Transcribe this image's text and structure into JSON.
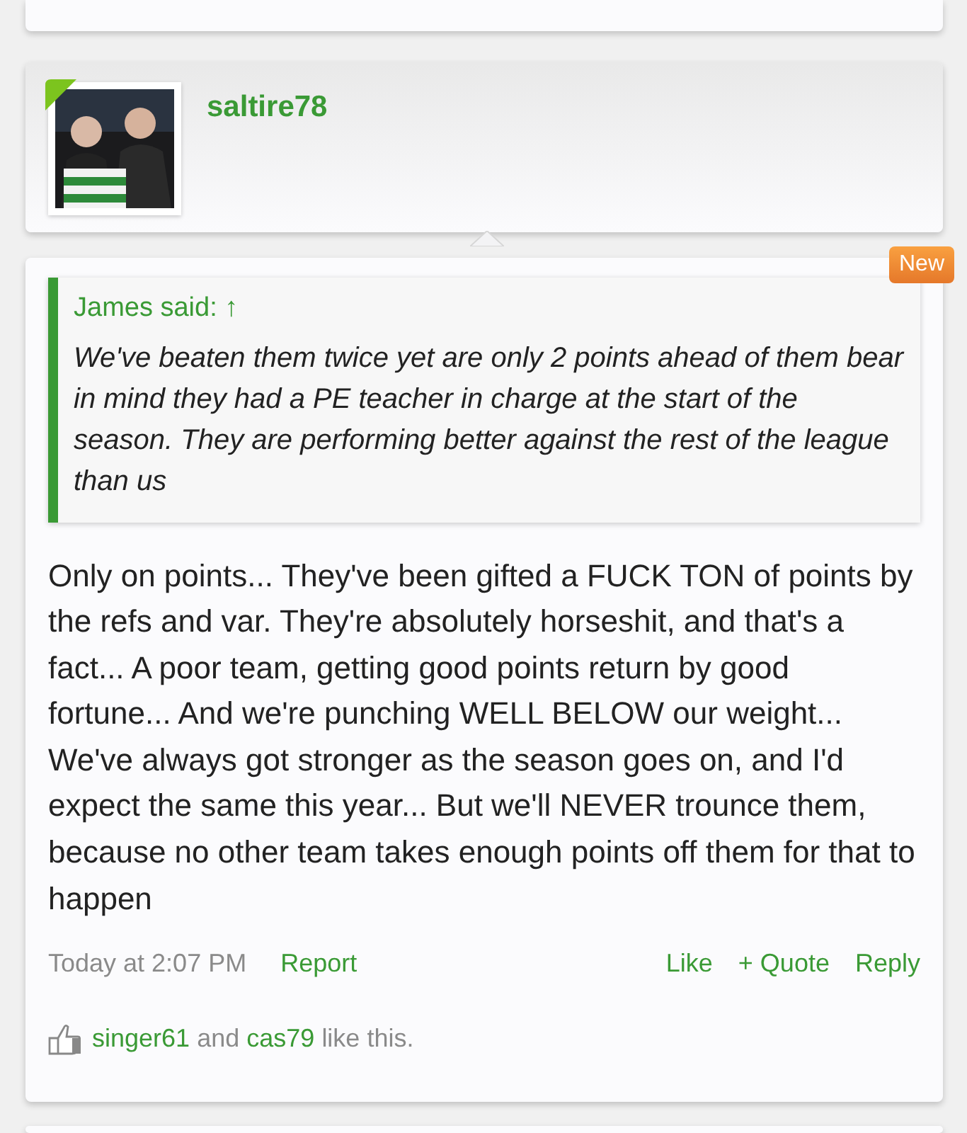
{
  "user": {
    "name": "saltire78"
  },
  "post": {
    "badge": "New",
    "quote": {
      "attribution": "James said: ↑",
      "text": "We've beaten them twice yet are only 2 points ahead of them bear in mind they had a PE teacher in charge at the start of the season. They are performing better against the rest of the league than us"
    },
    "body": "Only on points... They've been gifted a FUCK TON of points by the refs and var. They're absolutely horseshit, and that's a fact... A poor team, getting good points return by good fortune... And we're punching WELL BELOW our weight... We've always got stronger as the season goes on, and I'd expect the same this year... But we'll NEVER trounce them, because no other team takes enough points off them for that to happen",
    "time": "Today at 2:07 PM",
    "left_links": [
      "Report"
    ],
    "right_links": [
      "Like",
      "+ Quote",
      "Reply"
    ],
    "likes": [
      {
        "kind": "user",
        "text": "singer61"
      },
      {
        "kind": "text",
        "text": "and"
      },
      {
        "kind": "user",
        "text": "cas79"
      },
      {
        "kind": "text",
        "text": "like this."
      }
    ]
  }
}
